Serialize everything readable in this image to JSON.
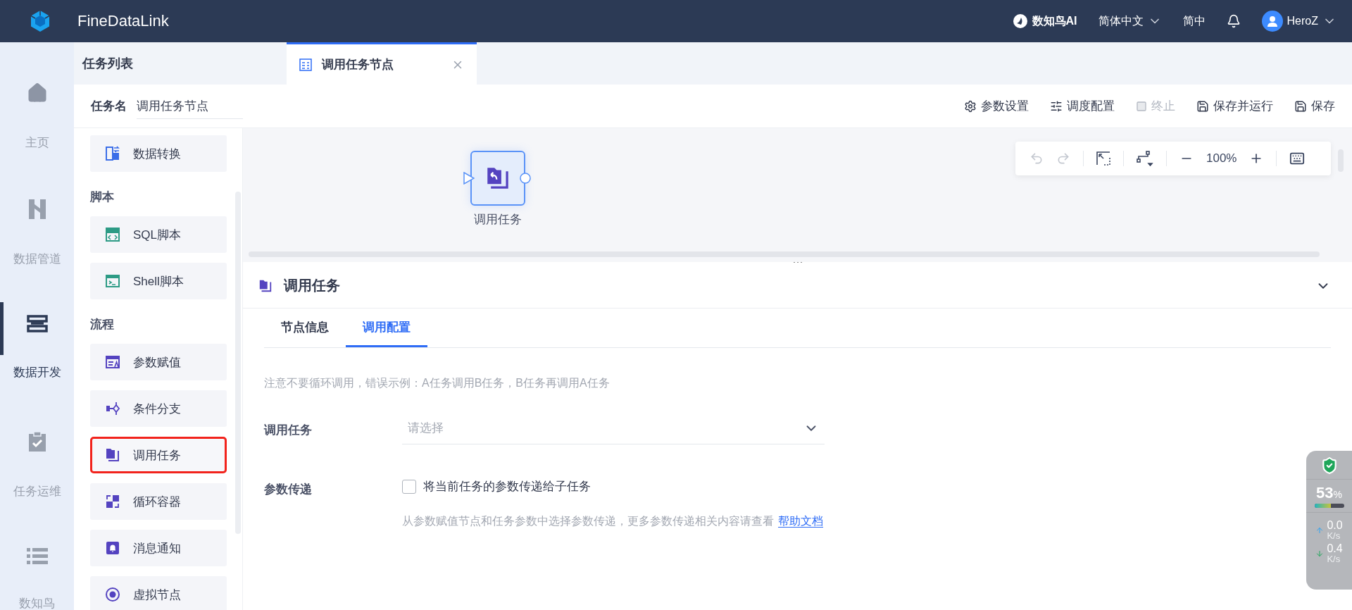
{
  "header": {
    "brand": "FineDataLink",
    "ai": "数知鸟AI",
    "language": "简体中文",
    "lang_short": "简中",
    "user": "HeroZ"
  },
  "nav": [
    {
      "label": "主页",
      "selected": false
    },
    {
      "label": "数据管道",
      "selected": false
    },
    {
      "label": "数据开发",
      "selected": true
    },
    {
      "label": "任务运维",
      "selected": false
    },
    {
      "label": "数知鸟",
      "selected": false
    }
  ],
  "panel": {
    "title": "任务列表",
    "task_name_label": "任务名",
    "task_name_value": "调用任务节点"
  },
  "palette": [
    {
      "items": [
        {
          "label": "数据转换",
          "highlighted": false
        }
      ]
    },
    {
      "heading": "脚本",
      "items": [
        {
          "label": "SQL脚本",
          "highlighted": false
        },
        {
          "label": "Shell脚本",
          "highlighted": false
        }
      ]
    },
    {
      "heading": "流程",
      "items": [
        {
          "label": "参数赋值",
          "highlighted": false
        },
        {
          "label": "条件分支",
          "highlighted": false
        },
        {
          "label": "调用任务",
          "highlighted": true
        },
        {
          "label": "循环容器",
          "highlighted": false
        },
        {
          "label": "消息通知",
          "highlighted": false
        },
        {
          "label": "虚拟节点",
          "highlighted": false
        }
      ]
    }
  ],
  "tabs": [
    {
      "label": "调用任务节点",
      "selected": true
    }
  ],
  "actions": [
    {
      "label": "参数设置",
      "disabled": false
    },
    {
      "label": "调度配置",
      "disabled": false
    },
    {
      "label": "终止",
      "disabled": true
    },
    {
      "label": "保存并运行",
      "disabled": false
    },
    {
      "label": "保存",
      "disabled": false
    }
  ],
  "canvas": {
    "node": {
      "label": "调用任务",
      "selected": true
    },
    "zoom": "100%",
    "undo_disabled": true,
    "redo_disabled": true
  },
  "detail": {
    "title": "调用任务",
    "expanded": true,
    "tabs": [
      {
        "label": "节点信息",
        "selected": false
      },
      {
        "label": "调用配置",
        "selected": true
      }
    ],
    "note": "注意不要循环调用，错误示例：A任务调用B任务，B任务再调用A任务",
    "fields": [
      {
        "kind": "select",
        "label": "调用任务",
        "placeholder": "请选择"
      },
      {
        "kind": "checkbox",
        "label": "参数传递",
        "checked": false,
        "text": "将当前任务的参数传递给子任务",
        "help": "从参数赋值节点和任务参数中选择参数传递，更多参数传递相关内容请查看",
        "link": "帮助文档"
      }
    ]
  },
  "monitor": {
    "percent": "53",
    "unit": "%",
    "level": 0.55,
    "up": "0.0",
    "up_unit": "K/s",
    "down": "0.4",
    "down_unit": "K/s"
  }
}
